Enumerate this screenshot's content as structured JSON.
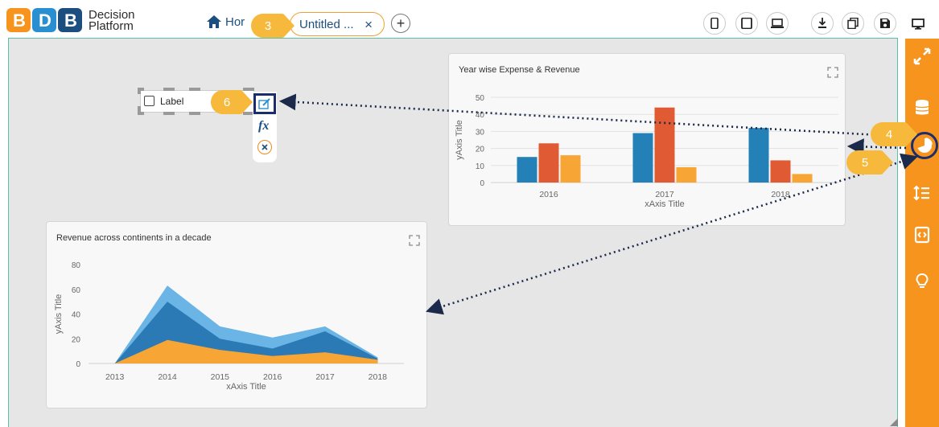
{
  "app": {
    "logo_line1": "Decision",
    "logo_line2": "Platform",
    "home_label": "Hor",
    "tab_label": "Untitled ...",
    "tab_close": "×",
    "add_tab": "+"
  },
  "toolbar": {
    "icons": [
      "mobile-icon",
      "tablet-icon",
      "laptop-icon",
      "download-icon",
      "copy-icon",
      "save-icon",
      "monitor-icon"
    ]
  },
  "callouts": {
    "c3": "3",
    "c4": "4",
    "c5": "5",
    "c6": "6"
  },
  "label_widget": {
    "text": "Label",
    "fx": "fx"
  },
  "right_panel": {
    "icons": [
      "expand-icon",
      "database-icon",
      "chart-pie-icon",
      "line-height-icon",
      "code-icon",
      "lightbulb-icon"
    ]
  },
  "colors": {
    "orange": "#f7941d",
    "blue": "#2381b8",
    "red": "#e05a33",
    "amber": "#f7a535",
    "navy": "#1c4f80"
  },
  "chart_data": [
    {
      "type": "bar",
      "title": "Year wise Expense & Revenue",
      "xlabel": "xAxis Title",
      "ylabel": "yAxis Title",
      "categories": [
        "2016",
        "2017",
        "2018"
      ],
      "ylim": [
        0,
        50
      ],
      "yticks": [
        "0",
        "10",
        "20",
        "30",
        "40",
        "50"
      ],
      "series": [
        {
          "values": [
            15,
            29,
            32
          ],
          "color": "#2381b8"
        },
        {
          "values": [
            23,
            44,
            13
          ],
          "color": "#e05a33"
        },
        {
          "values": [
            16,
            9,
            5
          ],
          "color": "#f7a535"
        }
      ]
    },
    {
      "type": "area",
      "title": "Revenue across continents in a decade",
      "xlabel": "xAxis Title",
      "ylabel": "yAxis Title",
      "categories": [
        "2013",
        "2014",
        "2015",
        "2016",
        "2017",
        "2018"
      ],
      "ylim": [
        0,
        80
      ],
      "yticks": [
        "0",
        "20",
        "40",
        "60",
        "80"
      ],
      "series": [
        {
          "values": [
            0,
            63,
            30,
            21,
            30,
            5
          ],
          "color": "#6ab4e6"
        },
        {
          "values": [
            0,
            50,
            20,
            12,
            26,
            4
          ],
          "color": "#2b79b5"
        },
        {
          "values": [
            0,
            19,
            11,
            6,
            9,
            3
          ],
          "color": "#f7a535"
        }
      ]
    }
  ]
}
